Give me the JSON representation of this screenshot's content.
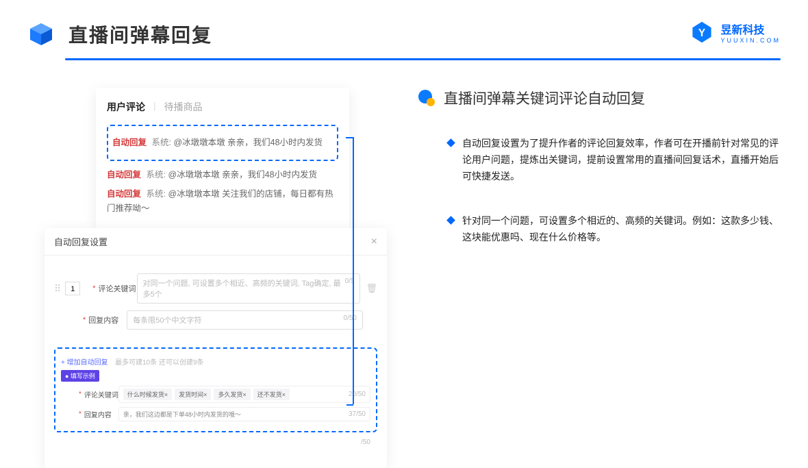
{
  "header": {
    "title": "直播间弹幕回复",
    "brand_name": "昱新科技",
    "brand_sub": "YUUXIN.COM"
  },
  "comment_card": {
    "tab_active": "用户评论",
    "tab_inactive": "待播商品",
    "highlight": {
      "tag": "自动回复",
      "sys": "系统:",
      "text": "@冰墩墩本墩 亲亲，我们48小时内发货"
    },
    "items": [
      {
        "tag": "自动回复",
        "sys": "系统:",
        "text": "@冰墩墩本墩 亲亲，我们48小时内发货"
      },
      {
        "tag": "自动回复",
        "sys": "系统:",
        "text": "@冰墩墩本墩 关注我们的店铺，每日都有热门推荐呦～"
      }
    ]
  },
  "settings": {
    "title": "自动回复设置",
    "row_num": "1",
    "keyword_label": "评论关键词",
    "keyword_placeholder": "对同一个问题, 可设置多个相近、高频的关键词, Tag确定, 最多5个",
    "keyword_count": "0/5",
    "content_label": "回复内容",
    "content_placeholder": "每条限50个中文字符",
    "content_count": "0/50",
    "add_link": "+ 增加自动回复",
    "add_hint": "最多可建10条 还可以创建9条",
    "example_badge": "● 填写示例",
    "example_keyword_label": "评论关键词",
    "example_tags": [
      "什么时候发货×",
      "发货时间×",
      "多久发货×",
      "还不发货×"
    ],
    "example_keyword_count": "20/50",
    "example_content_label": "回复内容",
    "example_content_text": "亲，我们这边都是下单48小时内发货的哦～",
    "example_content_count": "37/50",
    "outer_count": "/50"
  },
  "right": {
    "section_title": "直播间弹幕关键词评论自动回复",
    "bullets": [
      "自动回复设置为了提升作者的评论回复效率，作者可在开播前针对常见的评论用户问题，提炼出关键词，提前设置常用的直播间回复话术，直播开始后可快捷发送。",
      "针对同一个问题，可设置多个相近的、高频的关键词。例如：这款多少钱、这块能优惠吗、现在什么价格等。"
    ]
  }
}
